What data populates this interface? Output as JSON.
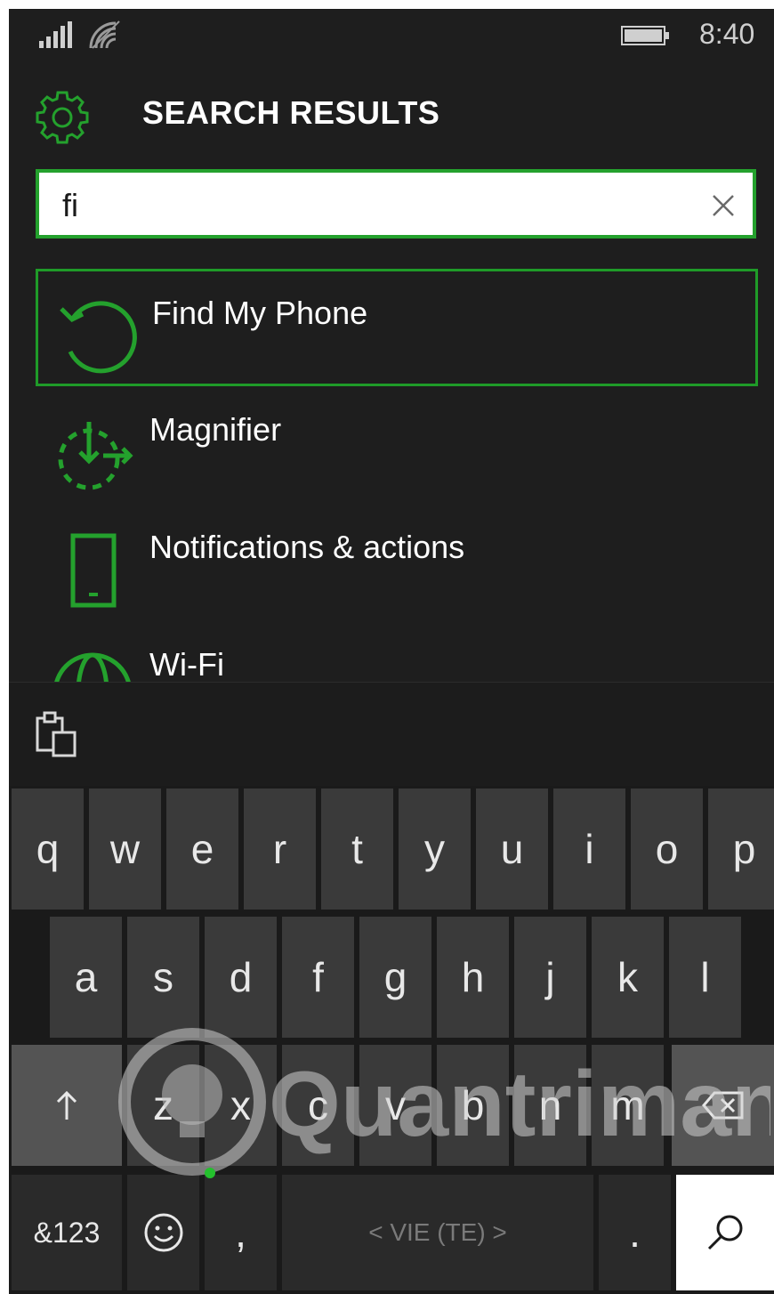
{
  "status": {
    "time": "8:40"
  },
  "header": {
    "title": "SEARCH RESULTS"
  },
  "search": {
    "value": "fi"
  },
  "results": [
    {
      "label": "Find My Phone",
      "icon": "history-icon",
      "selected": true
    },
    {
      "label": "Magnifier",
      "icon": "magnifier-icon",
      "selected": false
    },
    {
      "label": "Notifications & actions",
      "icon": "phone-icon",
      "selected": false
    },
    {
      "label": "Wi-Fi",
      "icon": "globe-icon",
      "selected": false
    }
  ],
  "keyboard": {
    "row1": [
      "q",
      "w",
      "e",
      "r",
      "t",
      "y",
      "u",
      "i",
      "o",
      "p"
    ],
    "row2": [
      "a",
      "s",
      "d",
      "f",
      "g",
      "h",
      "j",
      "k",
      "l"
    ],
    "row3": [
      "z",
      "x",
      "c",
      "v",
      "b",
      "n",
      "m"
    ],
    "num_label": "&123",
    "comma": ",",
    "space_label": "< VIE (TE) >",
    "period": "."
  },
  "colors": {
    "accent": "#24a12d",
    "background": "#1e1e1e",
    "key": "#3a3a3a"
  },
  "watermark": {
    "text": "Quantrimang"
  }
}
